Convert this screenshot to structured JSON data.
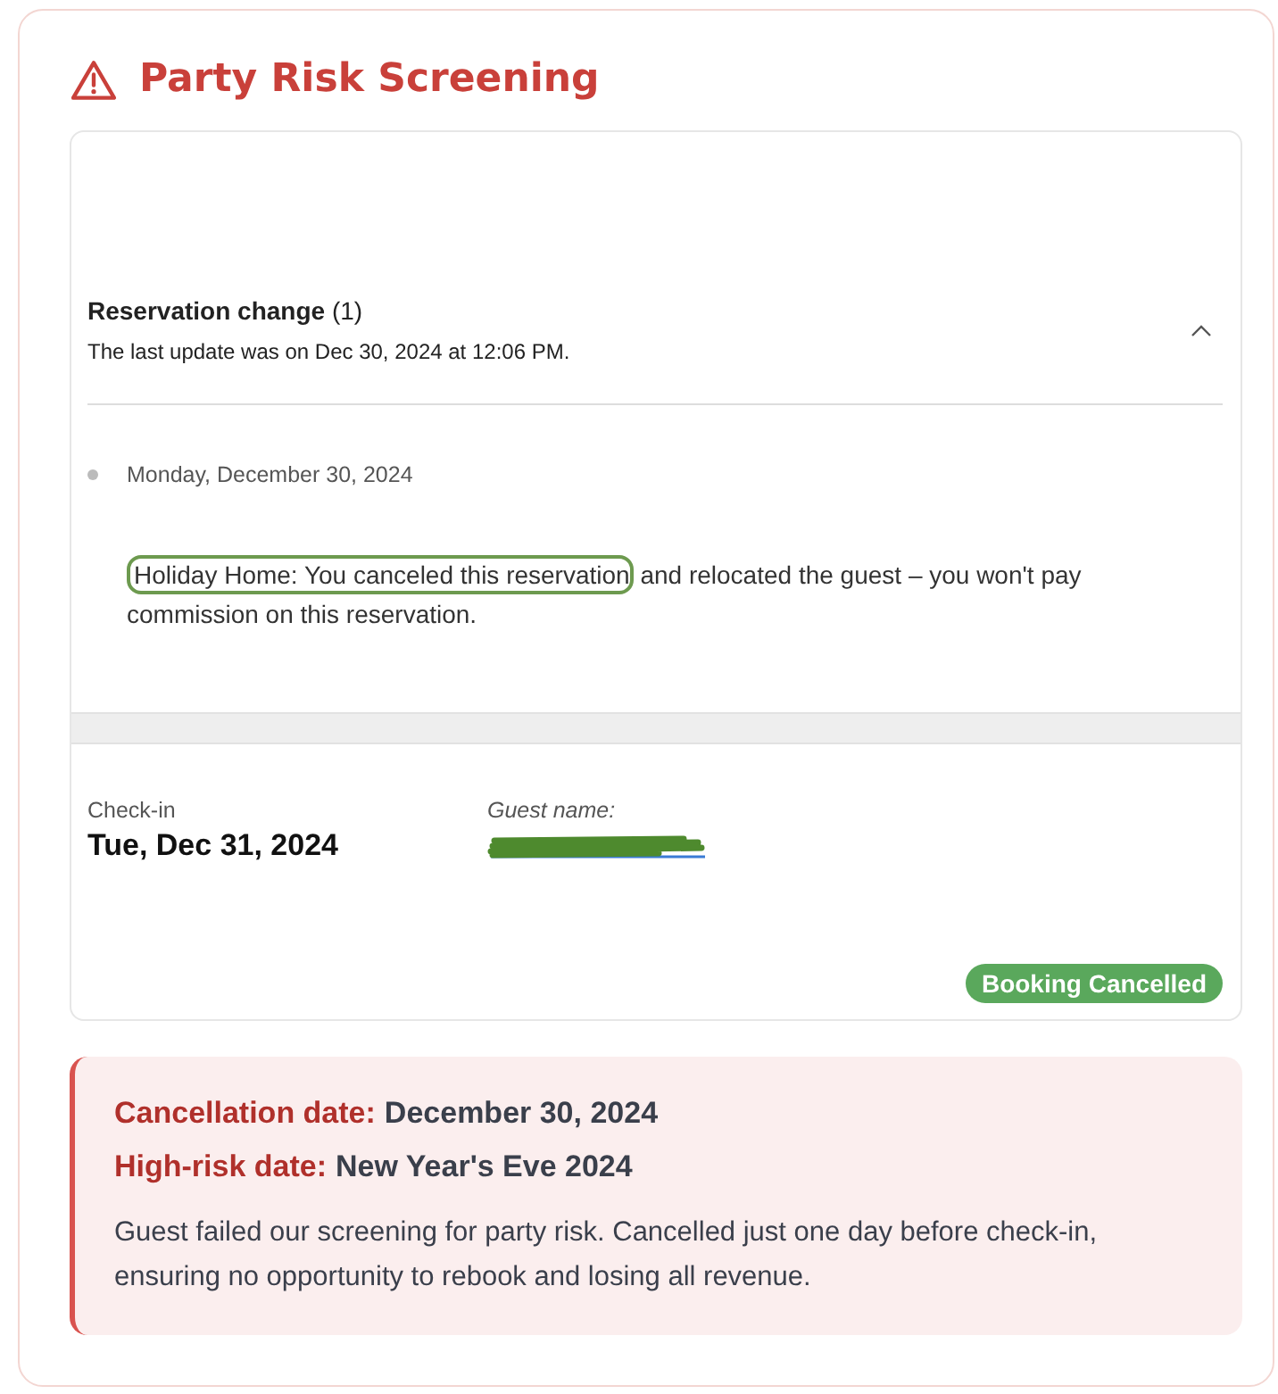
{
  "title": "Party Risk Screening",
  "reservation_change": {
    "heading": "**Reservation change** (1)",
    "subtitle": "The last update was on Dec 30, 2024 at 12:06 PM.",
    "expanded": true,
    "entries": [
      {
        "date": "Monday, December 30, 2024",
        "highlighted": "Holiday Home: You canceled this reservation",
        "text": " and relocated the guest – you won't pay commission on this reservation."
      }
    ]
  },
  "booking": {
    "checkin_label": "Check-in",
    "checkin_value": "Tue, Dec 31, 2024",
    "guest_label": "Guest name:",
    "guest_redacted": true,
    "status": "Booking Cancelled"
  },
  "alert": {
    "lines": [
      {
        "label": "Cancellation date:",
        "value": "December 30, 2024"
      },
      {
        "label": "High-risk date:",
        "value": "New Year's Eve 2024"
      }
    ],
    "description": "Guest failed our screening for party risk. Cancelled just one day before check-in, ensuring no opportunity to rebook and losing all revenue."
  }
}
